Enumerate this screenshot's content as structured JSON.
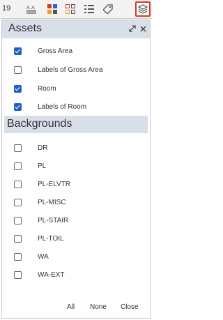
{
  "toolbar": {
    "count": "19",
    "icons": [
      "hierarchy-icon",
      "color-grid-icon",
      "outline-grid-icon",
      "list-icon",
      "tag-icon",
      "layers-icon"
    ]
  },
  "panel": {
    "title": "Assets",
    "expand_icon": "expand-icon",
    "close_icon": "close-icon"
  },
  "items": [
    {
      "label": "Gross Area",
      "checked": true
    },
    {
      "label": "Labels of Gross Area",
      "checked": false
    },
    {
      "label": "Room",
      "checked": true
    },
    {
      "label": "Labels of Room",
      "checked": true
    }
  ],
  "backgrounds": {
    "title": "Backgrounds",
    "items": [
      {
        "label": "DR",
        "checked": false
      },
      {
        "label": "PL",
        "checked": false
      },
      {
        "label": "PL-ELVTR",
        "checked": false
      },
      {
        "label": "PL-MISC",
        "checked": false
      },
      {
        "label": "PL-STAIR",
        "checked": false
      },
      {
        "label": "PL-TOIL",
        "checked": false
      },
      {
        "label": "WA",
        "checked": false
      },
      {
        "label": "WA-EXT",
        "checked": false
      }
    ]
  },
  "footer": {
    "all_label": "All",
    "none_label": "None",
    "close_label": "Close"
  },
  "colors": {
    "accent": "#1e61c6",
    "header_bg": "#d8dfe9",
    "active_border": "#d9352b"
  }
}
